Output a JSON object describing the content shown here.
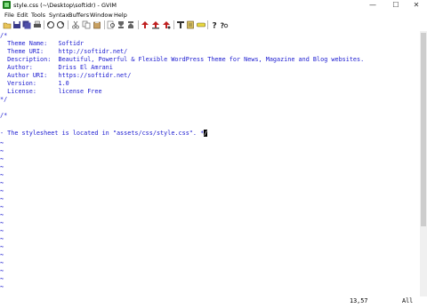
{
  "window": {
    "title": "style.css (~\\Desktop\\softidr) - GVIM",
    "minimize_glyph": "—",
    "maximize_glyph": "☐",
    "close_glyph": "✕"
  },
  "menu": [
    "File",
    "Edit",
    "Tools",
    "Syntax",
    "Buffers",
    "Window",
    "Help"
  ],
  "toolbar": {
    "icons": [
      "open-icon",
      "save-icon",
      "save-all-icon",
      "print-icon",
      "undo-icon",
      "redo-icon",
      "cut-icon",
      "copy-icon",
      "paste-icon",
      "find-replace-icon",
      "find-next-icon",
      "find-prev-icon",
      "load-session-icon",
      "save-session-icon",
      "run-script-icon",
      "make-icon",
      "run-ctags-icon",
      "tag-jump-icon",
      "help-icon",
      "find-help-icon"
    ]
  },
  "editor": {
    "lines": [
      "/*",
      "  Theme Name:   Softidr",
      "  Theme URI:    http://softidr.net/",
      "  Description:  Beautiful, Powerful & Flexible WordPress Theme for News, Magazine and Blog websites.",
      "  Author:       Driss El Amrani",
      "  Author URI:   https://softidr.net/",
      "  Version:      1.0",
      "  License:      license Free",
      "*/",
      "",
      "/*",
      "",
      "- The stylesheet is located in \"assets/css/style.css\". *"
    ],
    "cursor_char": "/",
    "tilde": "~",
    "tilde_count": 19
  },
  "status": {
    "position": "13,57",
    "scroll": "All"
  },
  "colors": {
    "text": "#1a1ad0",
    "background": "#ffffff",
    "cursor": "#000000"
  }
}
